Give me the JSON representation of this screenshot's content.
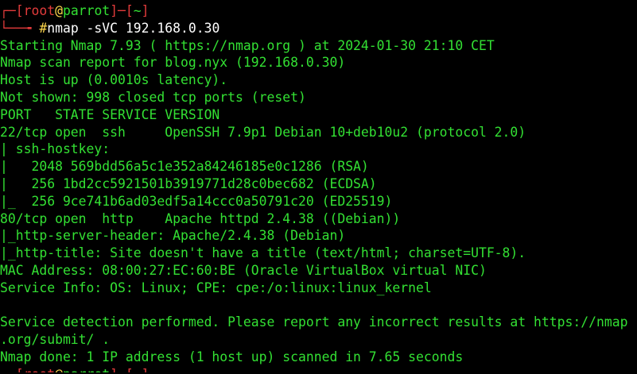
{
  "prompt": {
    "corner_top": "┌─[",
    "user": "root",
    "at": "@",
    "host": "parrot",
    "mid": "]─[",
    "cwd": "~",
    "end": "]",
    "corner_bottom": "└──╼ ",
    "symbol": "#",
    "command": "nmap -sVC 192.168.0.30"
  },
  "output": [
    "Starting Nmap 7.93 ( https://nmap.org ) at 2024-01-30 21:10 CET",
    "Nmap scan report for blog.nyx (192.168.0.30)",
    "Host is up (0.0010s latency).",
    "Not shown: 998 closed tcp ports (reset)",
    "PORT   STATE SERVICE VERSION",
    "22/tcp open  ssh     OpenSSH 7.9p1 Debian 10+deb10u2 (protocol 2.0)",
    "| ssh-hostkey: ",
    "|   2048 569bdd56a5c1e352a84246185e0c1286 (RSA)",
    "|   256 1bd2cc5921501b3919771d28c0bec682 (ECDSA)",
    "|_  256 9ce741b6ad03edf5a14ccc0a50791c20 (ED25519)",
    "80/tcp open  http    Apache httpd 2.4.38 ((Debian))",
    "|_http-server-header: Apache/2.4.38 (Debian)",
    "|_http-title: Site doesn't have a title (text/html; charset=UTF-8).",
    "MAC Address: 08:00:27:EC:60:BE (Oracle VirtualBox virtual NIC)",
    "Service Info: OS: Linux; CPE: cpe:/o:linux:linux_kernel",
    "",
    "Service detection performed. Please report any incorrect results at https://nmap",
    ".org/submit/ .",
    "Nmap done: 1 IP address (1 host up) scanned in 7.65 seconds"
  ],
  "next_prompt_partial": {
    "corner_top": "┌─[",
    "user": "root",
    "at": "@",
    "host": "parrot",
    "mid": "]─[",
    "cwd": "~",
    "end": "]"
  },
  "colors": {
    "background": "#000000",
    "output_text": "#33e033",
    "prompt_bracket": "#e23b3b",
    "prompt_host": "#ffd84d",
    "command_text": "#ffffff"
  }
}
